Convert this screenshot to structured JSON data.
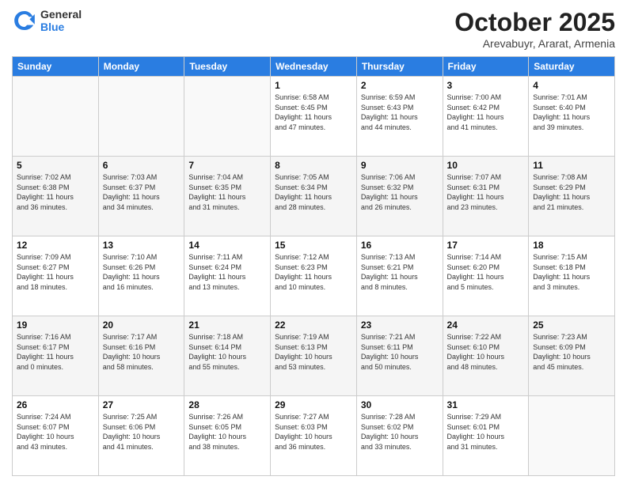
{
  "header": {
    "logo_general": "General",
    "logo_blue": "Blue",
    "month_title": "October 2025",
    "location": "Arevabuyr, Ararat, Armenia"
  },
  "days_of_week": [
    "Sunday",
    "Monday",
    "Tuesday",
    "Wednesday",
    "Thursday",
    "Friday",
    "Saturday"
  ],
  "weeks": [
    [
      {
        "day": "",
        "info": ""
      },
      {
        "day": "",
        "info": ""
      },
      {
        "day": "",
        "info": ""
      },
      {
        "day": "1",
        "info": "Sunrise: 6:58 AM\nSunset: 6:45 PM\nDaylight: 11 hours\nand 47 minutes."
      },
      {
        "day": "2",
        "info": "Sunrise: 6:59 AM\nSunset: 6:43 PM\nDaylight: 11 hours\nand 44 minutes."
      },
      {
        "day": "3",
        "info": "Sunrise: 7:00 AM\nSunset: 6:42 PM\nDaylight: 11 hours\nand 41 minutes."
      },
      {
        "day": "4",
        "info": "Sunrise: 7:01 AM\nSunset: 6:40 PM\nDaylight: 11 hours\nand 39 minutes."
      }
    ],
    [
      {
        "day": "5",
        "info": "Sunrise: 7:02 AM\nSunset: 6:38 PM\nDaylight: 11 hours\nand 36 minutes."
      },
      {
        "day": "6",
        "info": "Sunrise: 7:03 AM\nSunset: 6:37 PM\nDaylight: 11 hours\nand 34 minutes."
      },
      {
        "day": "7",
        "info": "Sunrise: 7:04 AM\nSunset: 6:35 PM\nDaylight: 11 hours\nand 31 minutes."
      },
      {
        "day": "8",
        "info": "Sunrise: 7:05 AM\nSunset: 6:34 PM\nDaylight: 11 hours\nand 28 minutes."
      },
      {
        "day": "9",
        "info": "Sunrise: 7:06 AM\nSunset: 6:32 PM\nDaylight: 11 hours\nand 26 minutes."
      },
      {
        "day": "10",
        "info": "Sunrise: 7:07 AM\nSunset: 6:31 PM\nDaylight: 11 hours\nand 23 minutes."
      },
      {
        "day": "11",
        "info": "Sunrise: 7:08 AM\nSunset: 6:29 PM\nDaylight: 11 hours\nand 21 minutes."
      }
    ],
    [
      {
        "day": "12",
        "info": "Sunrise: 7:09 AM\nSunset: 6:27 PM\nDaylight: 11 hours\nand 18 minutes."
      },
      {
        "day": "13",
        "info": "Sunrise: 7:10 AM\nSunset: 6:26 PM\nDaylight: 11 hours\nand 16 minutes."
      },
      {
        "day": "14",
        "info": "Sunrise: 7:11 AM\nSunset: 6:24 PM\nDaylight: 11 hours\nand 13 minutes."
      },
      {
        "day": "15",
        "info": "Sunrise: 7:12 AM\nSunset: 6:23 PM\nDaylight: 11 hours\nand 10 minutes."
      },
      {
        "day": "16",
        "info": "Sunrise: 7:13 AM\nSunset: 6:21 PM\nDaylight: 11 hours\nand 8 minutes."
      },
      {
        "day": "17",
        "info": "Sunrise: 7:14 AM\nSunset: 6:20 PM\nDaylight: 11 hours\nand 5 minutes."
      },
      {
        "day": "18",
        "info": "Sunrise: 7:15 AM\nSunset: 6:18 PM\nDaylight: 11 hours\nand 3 minutes."
      }
    ],
    [
      {
        "day": "19",
        "info": "Sunrise: 7:16 AM\nSunset: 6:17 PM\nDaylight: 11 hours\nand 0 minutes."
      },
      {
        "day": "20",
        "info": "Sunrise: 7:17 AM\nSunset: 6:16 PM\nDaylight: 10 hours\nand 58 minutes."
      },
      {
        "day": "21",
        "info": "Sunrise: 7:18 AM\nSunset: 6:14 PM\nDaylight: 10 hours\nand 55 minutes."
      },
      {
        "day": "22",
        "info": "Sunrise: 7:19 AM\nSunset: 6:13 PM\nDaylight: 10 hours\nand 53 minutes."
      },
      {
        "day": "23",
        "info": "Sunrise: 7:21 AM\nSunset: 6:11 PM\nDaylight: 10 hours\nand 50 minutes."
      },
      {
        "day": "24",
        "info": "Sunrise: 7:22 AM\nSunset: 6:10 PM\nDaylight: 10 hours\nand 48 minutes."
      },
      {
        "day": "25",
        "info": "Sunrise: 7:23 AM\nSunset: 6:09 PM\nDaylight: 10 hours\nand 45 minutes."
      }
    ],
    [
      {
        "day": "26",
        "info": "Sunrise: 7:24 AM\nSunset: 6:07 PM\nDaylight: 10 hours\nand 43 minutes."
      },
      {
        "day": "27",
        "info": "Sunrise: 7:25 AM\nSunset: 6:06 PM\nDaylight: 10 hours\nand 41 minutes."
      },
      {
        "day": "28",
        "info": "Sunrise: 7:26 AM\nSunset: 6:05 PM\nDaylight: 10 hours\nand 38 minutes."
      },
      {
        "day": "29",
        "info": "Sunrise: 7:27 AM\nSunset: 6:03 PM\nDaylight: 10 hours\nand 36 minutes."
      },
      {
        "day": "30",
        "info": "Sunrise: 7:28 AM\nSunset: 6:02 PM\nDaylight: 10 hours\nand 33 minutes."
      },
      {
        "day": "31",
        "info": "Sunrise: 7:29 AM\nSunset: 6:01 PM\nDaylight: 10 hours\nand 31 minutes."
      },
      {
        "day": "",
        "info": ""
      }
    ]
  ]
}
